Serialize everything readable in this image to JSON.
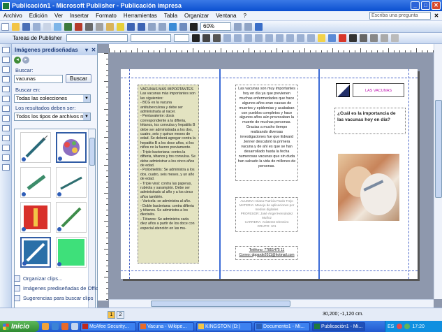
{
  "window": {
    "title": "Publicación1 - Microsoft Publisher - Publicación impresa"
  },
  "menu": {
    "items": [
      "Archivo",
      "Edición",
      "Ver",
      "Insertar",
      "Formato",
      "Herramientas",
      "Tabla",
      "Organizar",
      "Ventana",
      "?"
    ],
    "ask_placeholder": "Escriba una pregunta"
  },
  "toolbar": {
    "zoom": "60%"
  },
  "toolbar2": {
    "pub_tasks": "Tareas de Publisher"
  },
  "taskpane": {
    "title": "Imágenes prediseñadas",
    "search_label": "Buscar:",
    "search_value": "vacunas",
    "search_button": "Buscar",
    "search_in_label": "Buscar en:",
    "search_in_value": "Todas las colecciones",
    "results_label": "Los resultados deben ser:",
    "results_value": "Todos los tipos de archivos mult",
    "links": [
      "Organizar clips...",
      "Imágenes prediseñadas de Office e",
      "Sugerencias para buscar clips"
    ]
  },
  "document": {
    "left_panel": {
      "heading": "VACUNAS MÁS IMPORTANTES",
      "body": "Las vacunas más importantes son las siguientes:\n- BCG es la vacuna antituberculosa y debe ser administrada al nacer.\n- Pentavalente: dosis correspondiente a la difteria, tétanos, tos convulsa y hepatitis B debe ser administrada a los dos, cuatro, seis y quince meses de edad. Se deberá agregar contra la hepatitis B a los doce años, si los niños no la fueron previamente.\n- Triple bacteriana: contra la difteria, tétanos y tos convulsa. Se debe administrar a los cinco años de edad.\n- Poliomielitis: Se administra a los dos, cuatro, seis meses, y un año de edad.\n- Triple viral: contra las paperas, rubéola y sarampión. Debe ser administrado al año y a los cinco años también.\n- Varicela: se administra al año.\n- Doble bacteriana: contra difteria y tétanos. Se administra a los dieciséis.\n- Tétanos: Se administra cada diez años a partir de los doce con especial atención en las mu-"
    },
    "center_main": "Las vacunas son muy importantes hoy en día ya que previenen muchas enfermedades que hace algunos años eran causas de muertes y epidemias y acababan con pueblos completos y hace algunos años aún provocaban la muerte de muchas personas. Gracias a mucho tiempo realizando diversas investigaciones fue que Edward Jenner descubrió la primera vacuna y de ahí es que se han desarrollado hasta la fecha numerosas vacunas que sin duda han salvado la vida de millones de personas.",
    "center_credits": "ALUMNA: Diana Patricia Pardo Trejo\nMATERIA: Manejo de aplicaciones por medios digitales\nPROFESOR: José Ángel Hernández Muñoz\nCARRERA: Asistente Directivo\nGRUPO: 101",
    "center_contact_phone": "Teléfono: 77851475 11",
    "center_contact_email": "Correo: dpparde2011@hotmail.com",
    "right_logo_text": "LAS VACUNAS",
    "right_question": "¿Cuál es la importancia de las vacunas hoy en día?"
  },
  "status": {
    "pages": [
      "1",
      "2"
    ],
    "coords": "30,200; -1,120 cm."
  },
  "taskbar": {
    "start": "Inicio",
    "tasks": [
      "McAfee Security...",
      "Vacuna - Wikipe...",
      "KINGSTON (D:)",
      "Documento1 - Mi...",
      "Publicación1 - Mi..."
    ],
    "lang": "ES",
    "clock": "17:20"
  },
  "colors": {
    "titlebar": "#0a4fd0",
    "yellow_panel": "#e3e3c1",
    "logo_dark": "#23306a",
    "logo_text": "#c019b3",
    "guide_blue": "#3b6bd6"
  }
}
